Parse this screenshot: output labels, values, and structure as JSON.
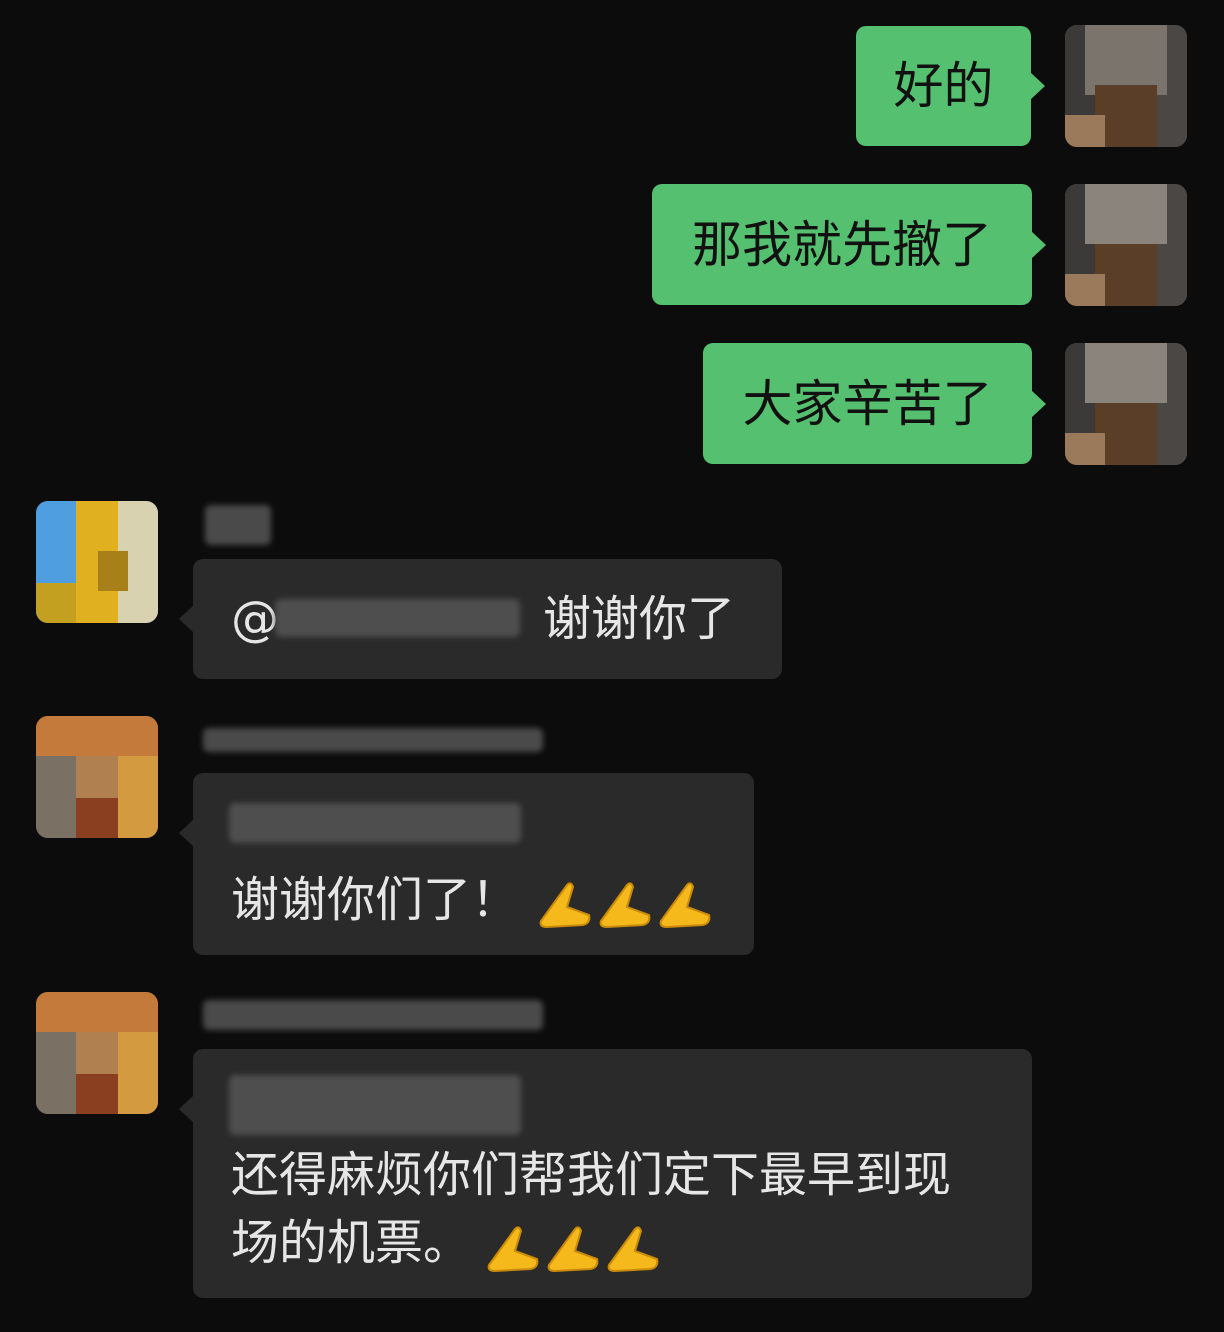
{
  "messages": {
    "sent": [
      {
        "text": "好的"
      },
      {
        "text": "那我就先撤了"
      },
      {
        "text": "大家辛苦了"
      }
    ],
    "received": [
      {
        "mention_prefix": "@",
        "text": "谢谢你了"
      },
      {
        "text": "谢谢你们了！",
        "emoji_count": "3"
      },
      {
        "line1": "还得麻烦你们帮我们定下最早到现",
        "line2": "场的机票。",
        "emoji_count": "3"
      }
    ]
  },
  "icons": {
    "emoji": "folded-hands-icon",
    "avatar": "pixelated-avatar"
  },
  "colors": {
    "background": "#0c0c0c",
    "sent_bubble": "#55c06f",
    "received_bubble": "#2a2a2a",
    "text_light": "#e6e6e6"
  }
}
